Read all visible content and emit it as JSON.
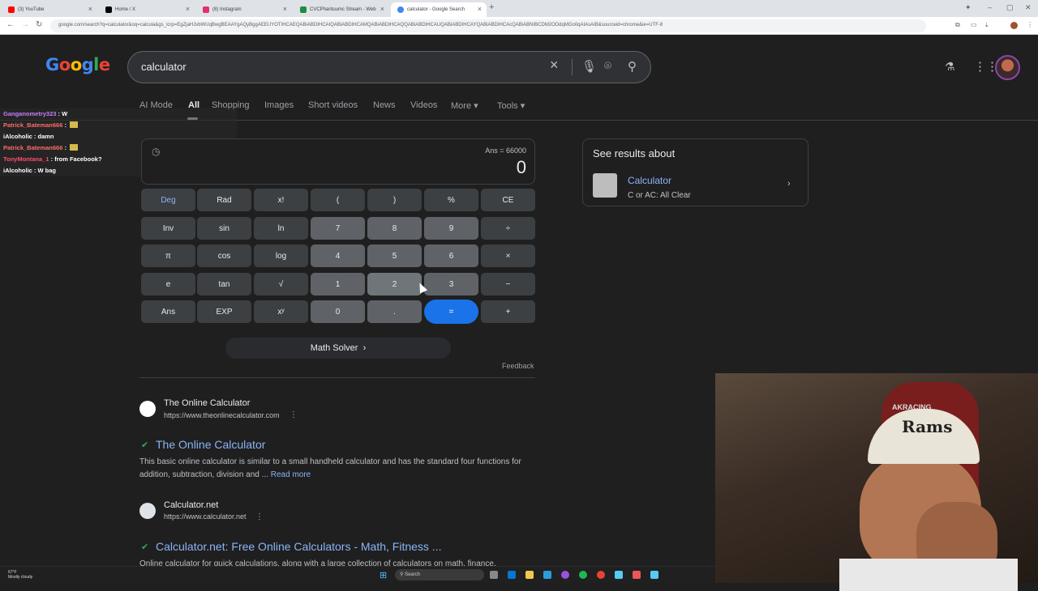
{
  "browser": {
    "tabs": [
      {
        "label": "(3) YouTube",
        "color": "#ff0000"
      },
      {
        "label": "Home / X",
        "color": "#000000"
      },
      {
        "label": "(8) Instagram",
        "color": "#e1306c"
      },
      {
        "label": "CVCPhantuumc Stream - Web",
        "color": "#1e8e3e"
      },
      {
        "label": "calculator - Google Search",
        "color": "#4285f4"
      }
    ],
    "url": "google.com/search?q=calculator&oq=calcula&gs_lcrp=EgZjaHJvbWUqBwgBEAAYgAQyBggAEEUYOTIHCAEQABiABDIHCAIQABiABDIHCAMQABiABDIHCAQQABiABDIHCAUQABiABDIHCAYQABiABDIHCAcQABiABNIBCDM2ODdqMGo0qAIAsAIB&sourceid=chrome&ie=UTF-8"
  },
  "google": {
    "logo": [
      "G",
      "o",
      "o",
      "g",
      "l",
      "e"
    ],
    "query": "calculator",
    "nav_tabs": [
      "AI Mode",
      "All",
      "Shopping",
      "Images",
      "Short videos",
      "News",
      "Videos",
      "More ▾",
      "Tools ▾"
    ],
    "active_tab": "All"
  },
  "chat": [
    {
      "name": "Ganganometry323",
      "msg": " : W",
      "cls": "c1"
    },
    {
      "name": "Patrick_Bateman666",
      "msg": " : ",
      "cls": "c2",
      "emote": true
    },
    {
      "name": "iAlcoholic",
      "msg": " : damn",
      "cls": "c3"
    },
    {
      "name": "Patrick_Bateman666",
      "msg": " : ",
      "cls": "c2",
      "emote": true
    },
    {
      "name": "TonyMontana_1",
      "msg": " : from Facebook?",
      "cls": "c4"
    },
    {
      "name": "iAlcoholic",
      "msg": " : W bag",
      "cls": "c3"
    }
  ],
  "calculator": {
    "ans_line": "Ans = 66000",
    "result": "0",
    "keys": [
      [
        "Deg",
        "Rad",
        "x!",
        "(",
        ")",
        "%",
        "CE"
      ],
      [
        "Inv",
        "sin",
        "ln",
        "7",
        "8",
        "9",
        "÷"
      ],
      [
        "π",
        "cos",
        "log",
        "4",
        "5",
        "6",
        "×"
      ],
      [
        "e",
        "tan",
        "√",
        "1",
        "2",
        "3",
        "−"
      ],
      [
        "Ans",
        "EXP",
        "xʸ",
        "0",
        ".",
        "=",
        "+"
      ]
    ],
    "math_solver": "Math Solver",
    "feedback": "Feedback"
  },
  "see_results": {
    "title": "See results about",
    "name": "Calculator",
    "sub": "C or AC: All Clear"
  },
  "results": [
    {
      "site": "The Online Calculator",
      "url": "https://www.theonlinecalculator.com",
      "title": "The Online Calculator",
      "snippet": "This basic online calculator is similar to a small handheld calculator and has the standard four functions for addition, subtraction, division and ... ",
      "readmore": "Read more"
    },
    {
      "site": "Calculator.net",
      "url": "https://www.calculator.net",
      "title": "Calculator.net: Free Online Calculators - Math, Fitness ...",
      "snippet": "Online calculator for quick calculations, along with a large collection of calculators on math, finance,"
    }
  ],
  "webcam": {
    "cap_text": "Rams",
    "chair_text": "AKRACING"
  },
  "taskbar": {
    "weather_temp": "67°F",
    "weather_desc": "Mostly cloudy",
    "search": "Search"
  },
  "colors": {
    "accent": "#8ab4f8",
    "equals": "#1a73e8",
    "background": "#1f1f1f"
  }
}
